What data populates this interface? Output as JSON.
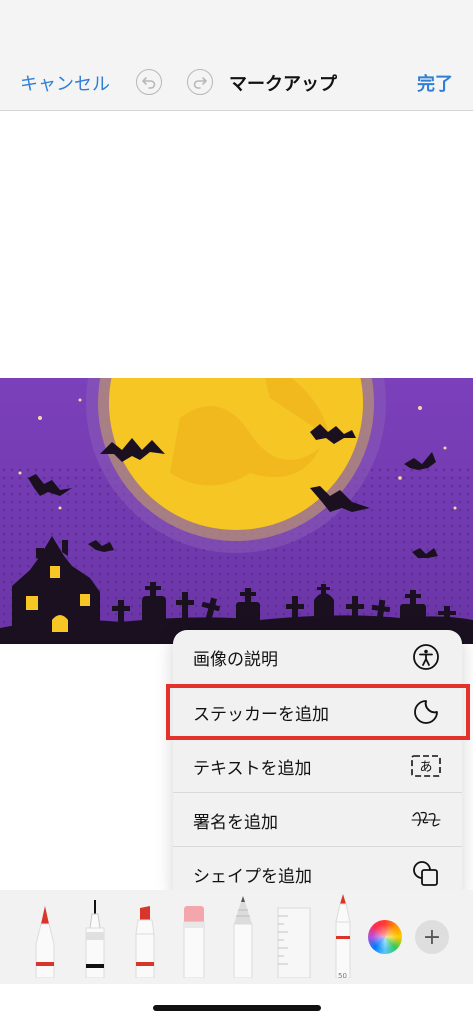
{
  "nav": {
    "cancel": "キャンセル",
    "title": "マークアップ",
    "done": "完了",
    "undo_icon": "undo-icon",
    "redo_icon": "redo-icon"
  },
  "menu": {
    "items": [
      {
        "label": "画像の説明",
        "icon": "accessibility-icon"
      },
      {
        "label": "ステッカーを追加",
        "icon": "sticker-icon"
      },
      {
        "label": "テキストを追加",
        "icon": "text-box-icon"
      },
      {
        "label": "署名を追加",
        "icon": "signature-icon"
      },
      {
        "label": "シェイプを追加",
        "icon": "shapes-icon"
      }
    ],
    "highlighted_index": 1,
    "highlight_color": "#e3312b"
  },
  "toolbar": {
    "tools": [
      "pen",
      "fineliner",
      "marker",
      "eraser",
      "pencil",
      "ruler",
      "crayon"
    ],
    "ruler_value": "50",
    "add_label": "+"
  },
  "colors": {
    "accent": "#2f7fd6",
    "pen_red": "#d8352b",
    "image_purple": "#7a3db8",
    "moon_yellow": "#f6c624"
  },
  "text_icon_glyph": "あ"
}
